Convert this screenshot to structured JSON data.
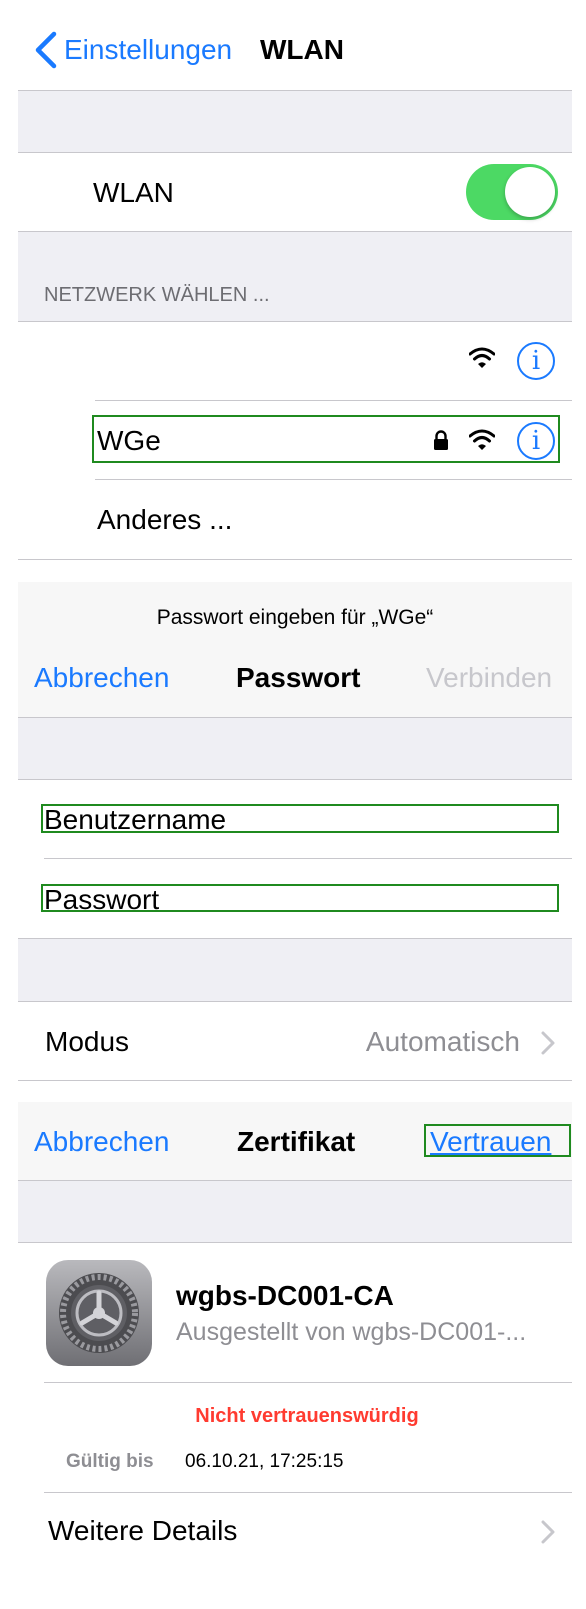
{
  "nav": {
    "back_label": "Einstellungen",
    "title": "WLAN"
  },
  "wlan_toggle": {
    "label": "WLAN",
    "state": "on",
    "color": "#4cd964"
  },
  "networks": {
    "section_header": "NETZWERK WÄHLEN ...",
    "items": [
      {
        "name": "",
        "locked": false,
        "icons": [
          "wifi-icon",
          "info-icon"
        ]
      },
      {
        "name": "WGe",
        "locked": true,
        "icons": [
          "lock-icon",
          "wifi-icon",
          "info-icon"
        ]
      }
    ],
    "other": "Anderes ..."
  },
  "password_sheet": {
    "prompt": "Passwort eingeben für „WGe“",
    "cancel": "Abbrechen",
    "title": "Passwort",
    "connect": "Verbinden",
    "username_placeholder": "Benutzername",
    "password_placeholder": "Passwort",
    "mode_label": "Modus",
    "mode_value": "Automatisch"
  },
  "certificate_sheet": {
    "cancel": "Abbrechen",
    "title": "Zertifikat",
    "trust": "Vertrauen",
    "cert_name": "wgbs-DC001-CA",
    "issued_by": "Ausgestellt von wgbs-DC001-...",
    "warning": "Nicht vertrauenswürdig",
    "valid_label": "Gültig bis",
    "valid_value": "06.10.21, 17:25:15",
    "more_details": "Weitere Details",
    "icon": "settings-gear-icon"
  },
  "colors": {
    "accent": "#1a7aff",
    "warning": "#ff3b30",
    "disabled": "#c7c7cc",
    "secondary_text": "#8e8e93"
  }
}
